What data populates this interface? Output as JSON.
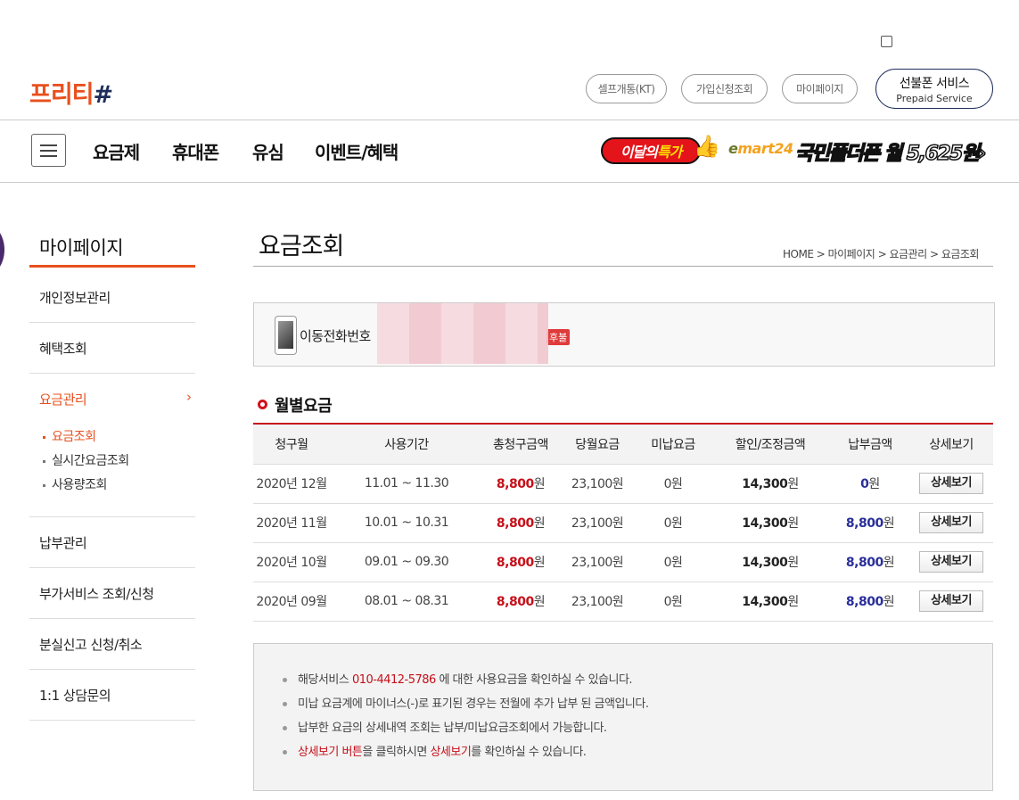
{
  "header": {
    "logo": {
      "text": "프리티",
      "mark": "#"
    },
    "links": [
      "셀프개통(KT)",
      "가입신청조회",
      "마이페이지"
    ],
    "prepaid": {
      "title": "선불폰 서비스",
      "subtitle": "Prepaid Service"
    }
  },
  "nav": {
    "items": [
      "요금제",
      "휴대폰",
      "유심",
      "이벤트/혜택"
    ],
    "promo_monthly": {
      "a": "이달의",
      "b": "특가"
    },
    "promo_emart": {
      "e": "e",
      "rest": "mart24"
    },
    "promo_phone": {
      "a": "국민",
      "b": "폴더폰",
      "c": " 월 5,625원",
      "arrow": "›"
    }
  },
  "sidebar": {
    "title": "마이페이지",
    "items": [
      {
        "label": "개인정보관리"
      },
      {
        "label": "혜택조회"
      },
      {
        "label": "요금관리",
        "chevron": "›"
      },
      {
        "label": "납부관리"
      },
      {
        "label": "부가서비스 조회/신청"
      },
      {
        "label": "분실신고 신청/취소"
      },
      {
        "label": "1:1 상담문의"
      }
    ],
    "subitems": [
      "요금조회",
      "실시간요금조회",
      "사용량조회"
    ]
  },
  "main": {
    "title": "요금조회",
    "breadcrumb": "HOME > 마이페이지 > 요금관리 > 요금조회",
    "phone_label": "이동전화번호",
    "phone_badge": "후불",
    "section_title": "월별요금"
  },
  "table": {
    "headers": [
      "청구월",
      "사용기간",
      "총청구금액",
      "당월요금",
      "미납요금",
      "할인/조정금액",
      "납부금액",
      "상세보기"
    ],
    "won": "원",
    "rows": [
      {
        "month": "2020년 12월",
        "period": "11.01 ~ 11.30",
        "total": "8,800",
        "current": "23,100원",
        "unpaid": "0원",
        "discount": "14,300",
        "paid": "0",
        "button": "상세보기"
      },
      {
        "month": "2020년 11월",
        "period": "10.01 ~ 10.31",
        "total": "8,800",
        "current": "23,100원",
        "unpaid": "0원",
        "discount": "14,300",
        "paid": "8,800",
        "button": "상세보기"
      },
      {
        "month": "2020년 10월",
        "period": "09.01 ~ 09.30",
        "total": "8,800",
        "current": "23,100원",
        "unpaid": "0원",
        "discount": "14,300",
        "paid": "8,800",
        "button": "상세보기"
      },
      {
        "month": "2020년 09월",
        "period": "08.01 ~ 08.31",
        "total": "8,800",
        "current": "23,100원",
        "unpaid": "0원",
        "discount": "14,300",
        "paid": "8,800",
        "button": "상세보기"
      }
    ]
  },
  "notice": {
    "line1": {
      "pre": "해당서비스 ",
      "phone": "010-4412-5786",
      "post": " 에 대한 사용요금을 확인하실 수 있습니다."
    },
    "line2": "미납 요금계에 마이너스(-)로 표기된 경우는 전월에 추가 납부 된 금액입니다.",
    "line3": "납부한 요금의 상세내역 조회는 납부/미납요금조회에서 가능합니다.",
    "line4": {
      "a": "상세보기 버튼",
      "b": "을 클릭하시면 ",
      "c": "상세보기",
      "d": "를 확인하실 수 있습니다."
    }
  },
  "colors": {
    "brand": "#e8501e",
    "accent_red": "#c6101a",
    "navy": "#1f2d5a",
    "paid_blue": "#2a2f9a"
  }
}
